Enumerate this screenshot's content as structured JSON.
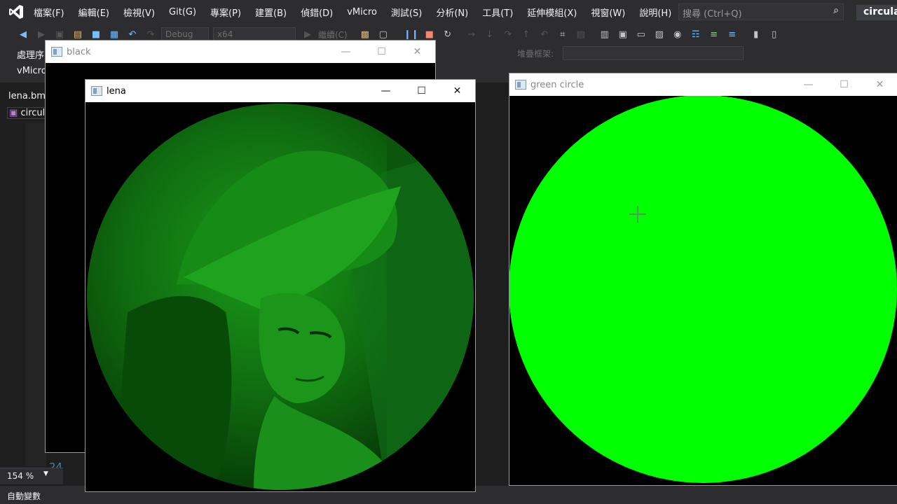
{
  "menubar": {
    "items": [
      "檔案(F)",
      "編輯(E)",
      "檢視(V)",
      "Git(G)",
      "專案(P)",
      "建置(B)",
      "偵錯(D)",
      "vMicro",
      "測試(S)",
      "分析(N)",
      "工具(T)",
      "延伸模組(X)",
      "視窗(W)",
      "說明(H)"
    ],
    "search_placeholder": "搜尋 (Ctrl+Q)",
    "solution_name": "circular"
  },
  "toolbar": {
    "config": "Debug",
    "platform": "x64",
    "continue_label": "繼續(C)",
    "stack_frame_label": "堆疊框架:"
  },
  "side": {
    "process_label": "處理序",
    "vmicro_label": "vMicro",
    "tab_file": "lena.bmp",
    "tab_project": "circula",
    "line_number": "24",
    "zoom": "154 %",
    "status": "自動變數"
  },
  "windows": {
    "black": {
      "title": "black"
    },
    "lena": {
      "title": "lena"
    },
    "green": {
      "title": "green circle"
    }
  },
  "colors": {
    "green": "#00ff00",
    "canvas_bg": "#000000",
    "vs_chrome": "#2d2d30"
  }
}
